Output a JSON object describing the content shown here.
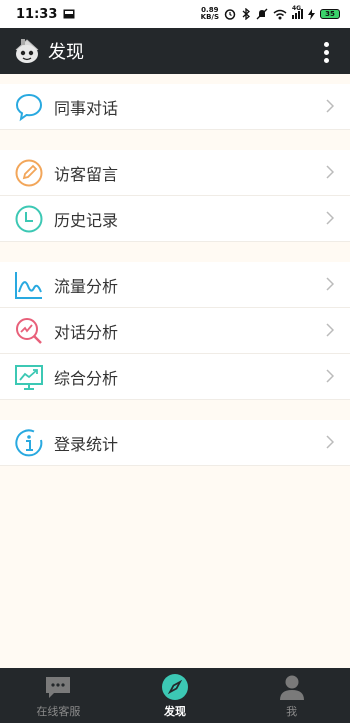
{
  "status_bar": {
    "time": "11:33",
    "net_speed_top": "0.89",
    "net_speed_bottom": "KB/S",
    "signal_label": "4G",
    "battery": "35"
  },
  "header": {
    "title": "发现"
  },
  "menu": {
    "colleague_chat": "同事对话",
    "visitor_messages": "访客留言",
    "history": "历史记录",
    "traffic_analysis": "流量分析",
    "chat_analysis": "对话分析",
    "overall_analysis": "综合分析",
    "login_stats": "登录统计"
  },
  "bottom_nav": {
    "online_service": "在线客服",
    "discover": "发现",
    "me": "我"
  },
  "colors": {
    "app_bar": "#24282b",
    "background": "#fffaf3",
    "accent_teal": "#3cc8b4"
  }
}
